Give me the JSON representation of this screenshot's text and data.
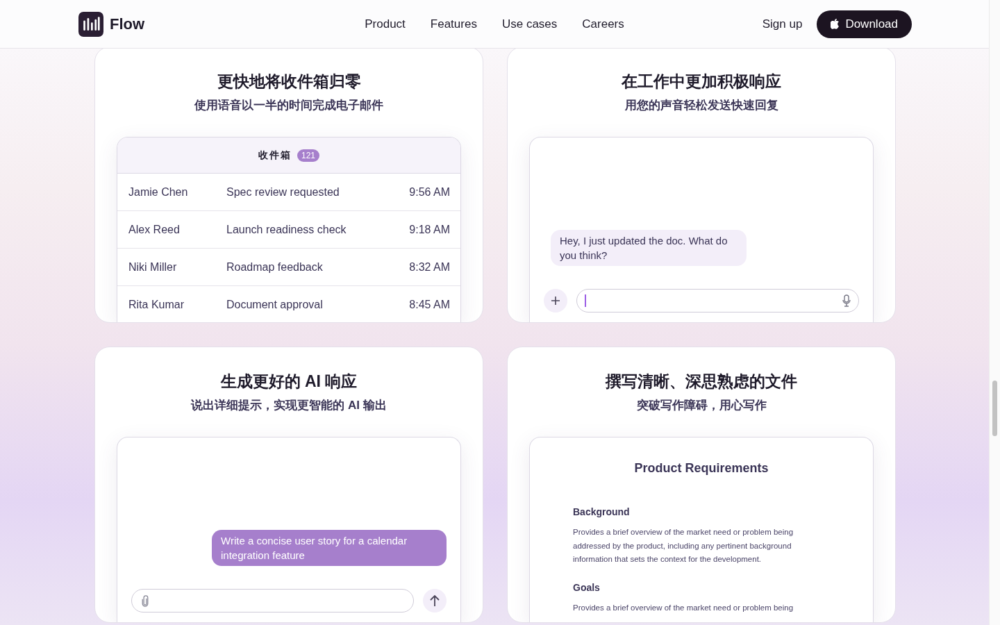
{
  "header": {
    "brand": "Flow",
    "nav": [
      "Product",
      "Features",
      "Use cases",
      "Careers"
    ],
    "sign_up": "Sign up",
    "download": "Download"
  },
  "cards": [
    {
      "kind": "inbox",
      "title": "更快地将收件箱归零",
      "subtitle": "使用语音以一半的时间完成电子邮件",
      "inbox": {
        "label": "收件箱",
        "count": "121",
        "rows": [
          {
            "sender": "Jamie Chen",
            "subject": "Spec review requested",
            "time": "9:56 AM"
          },
          {
            "sender": "Alex Reed",
            "subject": "Launch readiness check",
            "time": "9:18 AM"
          },
          {
            "sender": "Niki Miller",
            "subject": "Roadmap feedback",
            "time": "8:32 AM"
          },
          {
            "sender": "Rita Kumar",
            "subject": "Document approval",
            "time": "8:45 AM"
          }
        ]
      }
    },
    {
      "kind": "chat",
      "title": "在工作中更加积极响应",
      "subtitle": "用您的声音轻松发送快速回复",
      "message": "Hey, I just updated the doc. What do you think?"
    },
    {
      "kind": "prompt",
      "title": "生成更好的 AI 响应",
      "subtitle": "说出详细提示，实现更智能的 AI 输出",
      "message": "Write a concise user story for a calendar integration feature"
    },
    {
      "kind": "document",
      "title": "撰写清晰、深思熟虑的文件",
      "subtitle": "突破写作障碍，用心写作",
      "document": {
        "heading": "Product Requirements",
        "sections": [
          {
            "heading": "Background",
            "body": "Provides a brief overview of the market need or problem being addressed by the product, including any pertinent background information that sets the context for the development."
          },
          {
            "heading": "Goals",
            "body": "Provides a brief overview of the market need or problem being"
          }
        ]
      }
    }
  ]
}
